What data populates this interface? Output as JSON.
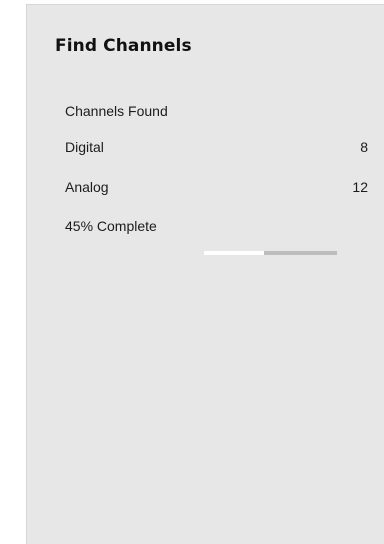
{
  "screen": {
    "title": "Find Channels",
    "section_label": "Channels Found",
    "rows": [
      {
        "label": "Digital",
        "value": "8"
      },
      {
        "label": "Analog",
        "value": "12"
      }
    ],
    "progress": {
      "label": "45% Complete",
      "fraction": 0.45
    }
  },
  "colors": {
    "panel_background": "#e7e7e7",
    "progress_track": "#bdbdbd",
    "progress_fill": "#ffffff"
  }
}
